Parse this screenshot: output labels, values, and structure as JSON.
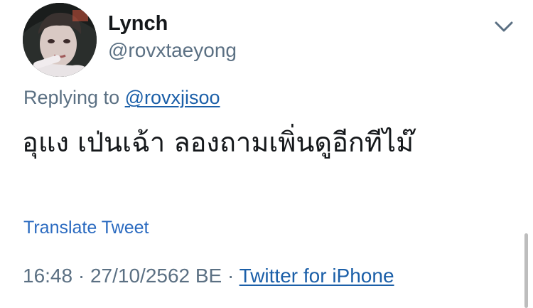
{
  "tweet": {
    "author": {
      "display_name": "Lynch",
      "handle": "@rovxtaeyong",
      "avatar_icon": "profile-photo"
    },
    "reply": {
      "prefix": "Replying to",
      "mention": "@rovxjisoo"
    },
    "text": "อุแง เป่นเฉ้า ลองถามเพิ่นดูอีกทีไม๊",
    "translate_label": "Translate Tweet",
    "time": "16:48",
    "separator": "·",
    "date": "27/10/2562 BE",
    "source": "Twitter for iPhone",
    "menu_icon": "chevron-down-icon"
  },
  "colors": {
    "primary_text": "#14171a",
    "secondary_text": "#5b7083",
    "link": "#1b5fa8"
  }
}
